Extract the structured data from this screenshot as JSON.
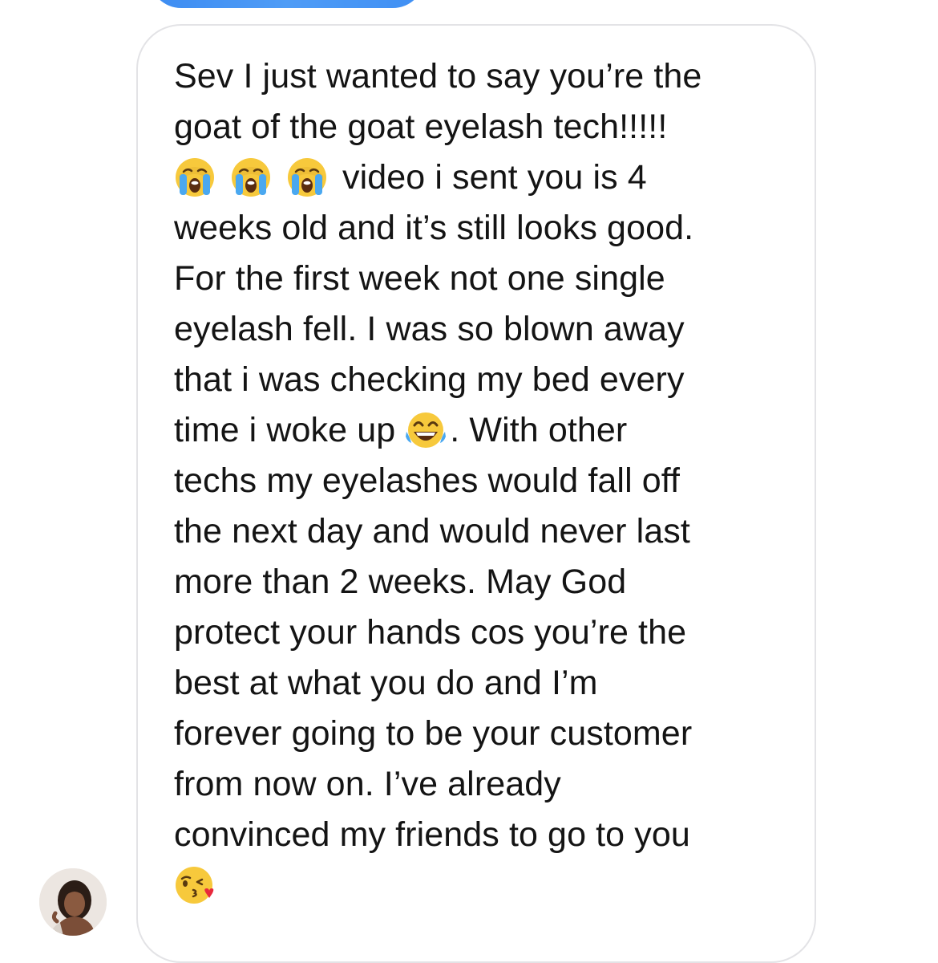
{
  "conversation": {
    "message": {
      "lines": [
        "Sev I just wanted to say you’re the",
        "goat of the goat eyelash tech!!!!!",
        "video i sent you is 4",
        "weeks old and it’s still looks good.",
        "For the first week not one single",
        "eyelash fell. I was so blown away",
        "that i was checking my bed every",
        "time i woke up",
        ". With other",
        "techs my eyelashes would fall off",
        "the next day and would never last",
        "more than 2 weeks. May God",
        "protect your hands cos you’re the",
        "best at what you do and I’m",
        "forever going to be your customer",
        "from now on. I’ve already",
        "convinced my friends to go to you"
      ],
      "emojis": {
        "crying": "loudly-crying-face-icon",
        "laughing": "face-with-tears-of-joy-icon",
        "kiss": "face-blowing-a-kiss-icon"
      }
    },
    "colors": {
      "sent_bubble": "#3d8cf2",
      "received_border": "#e3e3e6",
      "text": "#141414"
    }
  }
}
